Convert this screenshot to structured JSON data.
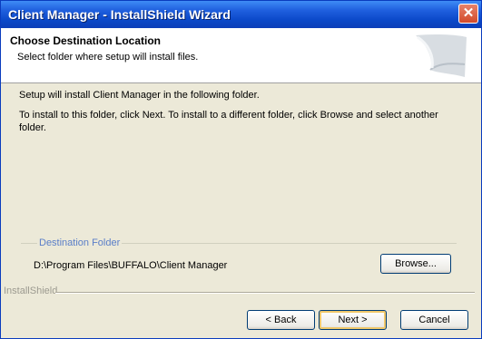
{
  "window": {
    "title": "Client Manager - InstallShield Wizard",
    "close_glyph": "✕"
  },
  "header": {
    "title": "Choose Destination Location",
    "subtitle": "Select folder where setup will install files."
  },
  "body": {
    "line1": "Setup will install Client Manager in the following folder.",
    "line2": "To install to this folder, click Next. To install to a different folder, click Browse and select another folder."
  },
  "destination": {
    "group_label": "Destination Folder",
    "path": "D:\\Program Files\\BUFFALO\\Client Manager",
    "browse_label": "Browse..."
  },
  "footer": {
    "brand": "InstallShield",
    "back_label": "< Back",
    "next_label": "Next >",
    "cancel_label": "Cancel"
  },
  "colors": {
    "titlebar": "#0B49C9",
    "dialog_bg": "#ECE9D8",
    "group_label": "#5A7EC8"
  },
  "icons": {
    "close": "close-icon",
    "logo": "installshield-logo-icon"
  }
}
